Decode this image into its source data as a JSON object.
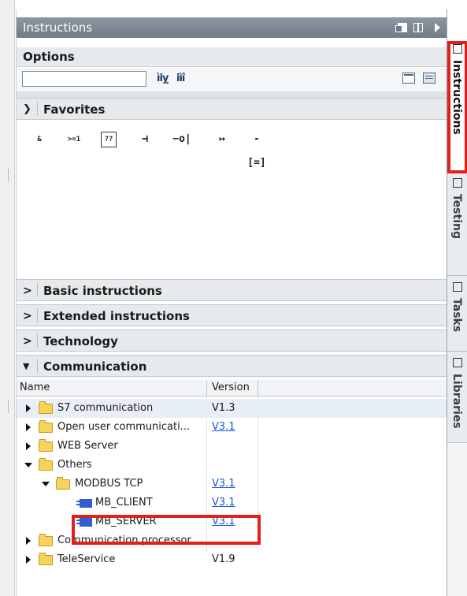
{
  "panel": {
    "title": "Instructions",
    "options_label": "Options",
    "search_placeholder": "",
    "search_icons": [
      "search-down-icon",
      "search-up-icon"
    ],
    "view_icons": [
      "panel-view-icon",
      "list-view-icon"
    ]
  },
  "sections": {
    "favorites": "Favorites",
    "basic": "Basic instructions",
    "extended": "Extended instructions",
    "technology": "Technology",
    "communication": "Communication"
  },
  "favorites": [
    "&",
    ">=1",
    "??",
    "⊣",
    "−o|",
    "↦",
    "-[=]"
  ],
  "columns": {
    "name": "Name",
    "version": "Version"
  },
  "tree": [
    {
      "label": "S7 communication",
      "version": "V1.3"
    },
    {
      "label": "Open user communicati...",
      "version": "V3.1"
    },
    {
      "label": "WEB Server",
      "version": ""
    },
    {
      "label": "Others",
      "version": ""
    },
    {
      "label": "MODBUS TCP",
      "version": "V3.1"
    },
    {
      "label": "MB_CLIENT",
      "version": "V3.1"
    },
    {
      "label": "MB_SERVER",
      "version": "V3.1"
    },
    {
      "label": "Communication processor",
      "version": ""
    },
    {
      "label": "TeleService",
      "version": "V1.9"
    }
  ],
  "side_tabs": {
    "instructions": "Instructions",
    "testing": "Testing",
    "tasks": "Tasks",
    "libraries": "Libraries"
  },
  "colors": {
    "title_bar": "#7b8691",
    "highlight": "#e0201c",
    "link": "#1a55d6",
    "folder": "#f6d35b",
    "block": "#2f5fd1"
  }
}
